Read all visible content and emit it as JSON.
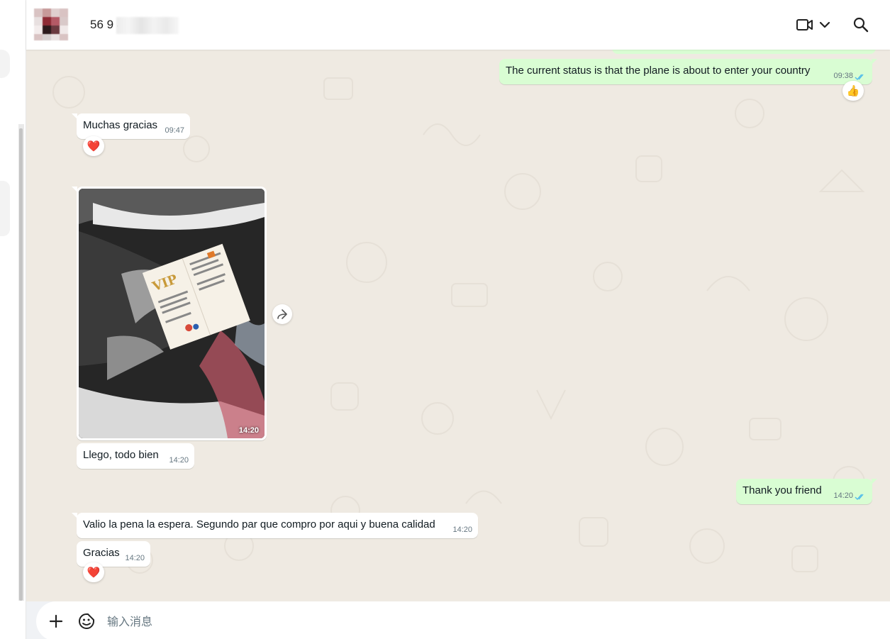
{
  "header": {
    "contact_name_visible": "56 9 4",
    "icons": [
      "video-call-icon",
      "chevron-down-icon",
      "search-icon"
    ]
  },
  "messages": [
    {
      "direction": "out",
      "text": "The current status is that the plane is about to enter your country",
      "time": "09:38",
      "status": "read",
      "reaction": "👍"
    },
    {
      "direction": "in",
      "text": "Muchas gracias",
      "time": "09:47",
      "reaction": "❤️"
    },
    {
      "direction": "in",
      "type": "image",
      "image_description": "sneakers in box with VIP card",
      "time": "14:20"
    },
    {
      "direction": "in",
      "text": "Llego, todo bien",
      "time": "14:20"
    },
    {
      "direction": "out",
      "text": "Thank you friend",
      "time": "14:20",
      "status": "read"
    },
    {
      "direction": "in",
      "text": "Valio la pena la espera. Segundo par que compro por aqui y buena calidad",
      "time": "14:20"
    },
    {
      "direction": "in",
      "text": "Gracias",
      "time": "14:20",
      "reaction": "❤️"
    }
  ],
  "composer": {
    "placeholder": "输入消息",
    "icons": [
      "plus-icon",
      "sticker-icon"
    ]
  },
  "colors": {
    "chat_background": "#efeae2",
    "outgoing_bubble": "#d9fdd3",
    "incoming_bubble": "#ffffff",
    "read_ticks": "#53bdeb",
    "timestamp": "#667781"
  }
}
